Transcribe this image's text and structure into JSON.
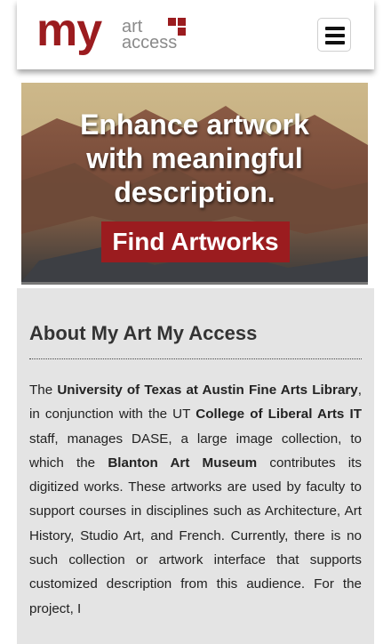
{
  "header": {
    "logo": {
      "my": "my",
      "art": "art",
      "access": "access"
    },
    "menu_button_label": "Menu"
  },
  "hero": {
    "title_line1": "Enhance artwork",
    "title_line2": "with meaningful",
    "title_line3": "description.",
    "cta_label": "Find Artworks"
  },
  "about": {
    "heading": "About My Art My Access",
    "p_the": "The",
    "p_ut_library": "University of Texas at Austin Fine Arts Library",
    "p_conj": ", in conjunction with the UT",
    "p_cola": "College of Liberal Arts IT",
    "p_mid": "staff, manages DASE, a large image collection, to which the",
    "p_blanton": "Blanton Art Museum",
    "p_rest": "contributes its digitized works. These artworks are used by faculty to support courses in disciplines such as Architecture, Art History, Studio Art, and French. Currently, there is no such collection or artwork interface that supports customized description from this audience. For the project, I"
  },
  "colors": {
    "brand_red": "#9b1c1f",
    "logo_gray": "#8a8a8a",
    "card_bg": "#e4e4e4"
  },
  "icons": [
    "hamburger-menu-icon"
  ]
}
